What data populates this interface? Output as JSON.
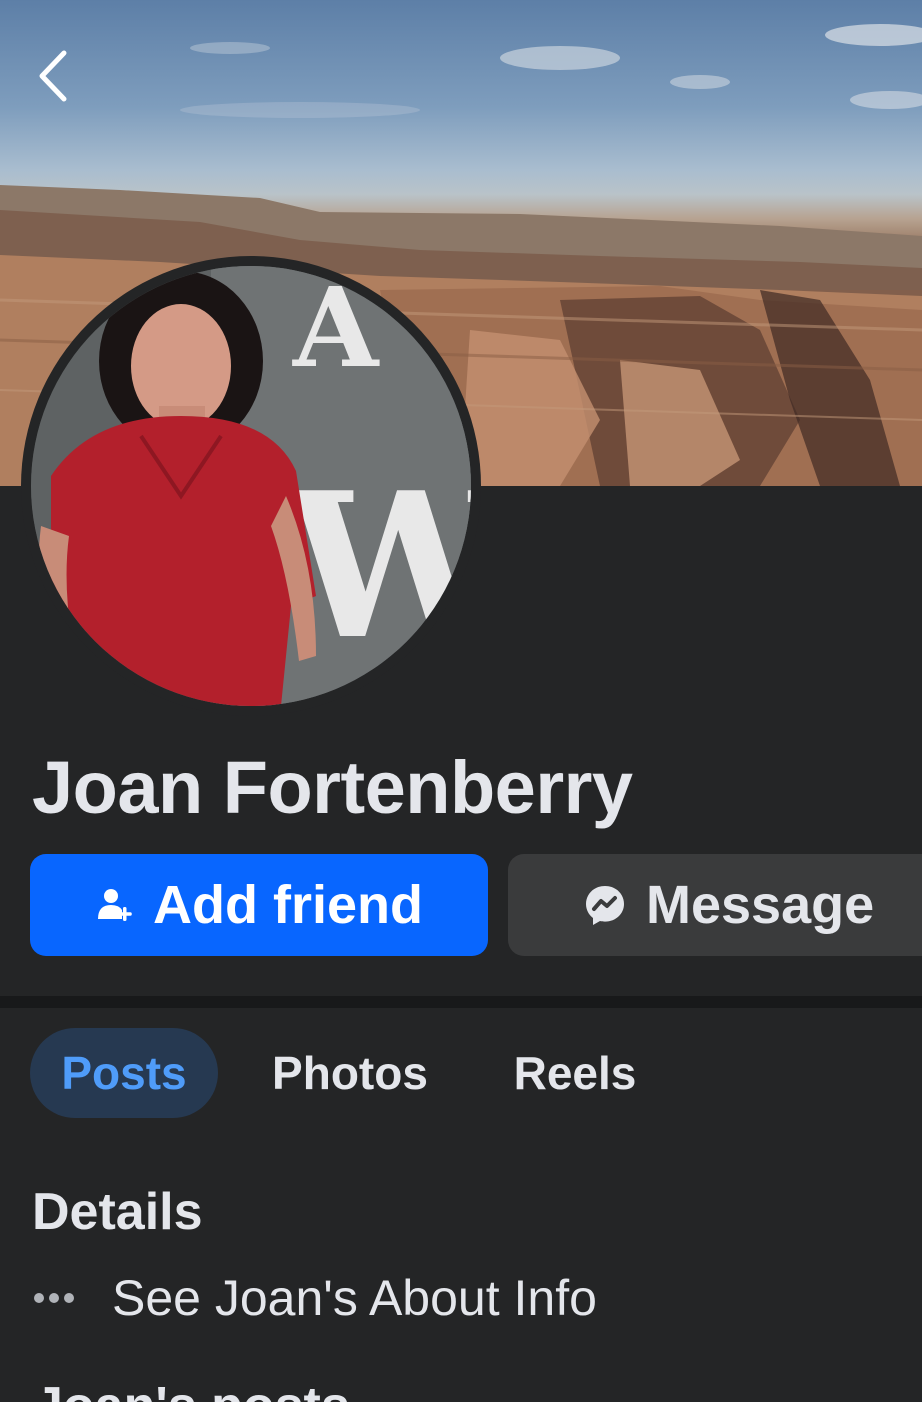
{
  "nav": {
    "back_icon": "chevron-left-icon"
  },
  "profile": {
    "name": "Joan Fortenberry"
  },
  "actions": {
    "add_friend_label": "Add friend",
    "add_friend_icon": "person-add-icon",
    "message_label": "Message",
    "message_icon": "messenger-icon"
  },
  "tabs": [
    {
      "label": "Posts",
      "active": true
    },
    {
      "label": "Photos",
      "active": false
    },
    {
      "label": "Reels",
      "active": false
    }
  ],
  "details": {
    "title": "Details",
    "about_label": "See Joan's About Info",
    "about_icon": "more-dots-icon"
  },
  "posts_section": {
    "title": "Joan's posts"
  },
  "colors": {
    "background": "#242526",
    "primary_button": "#0866ff",
    "secondary_button": "#3a3b3c",
    "active_tab_bg": "#263951",
    "active_tab_text": "#4f9cf9",
    "text": "#e4e6eb"
  }
}
